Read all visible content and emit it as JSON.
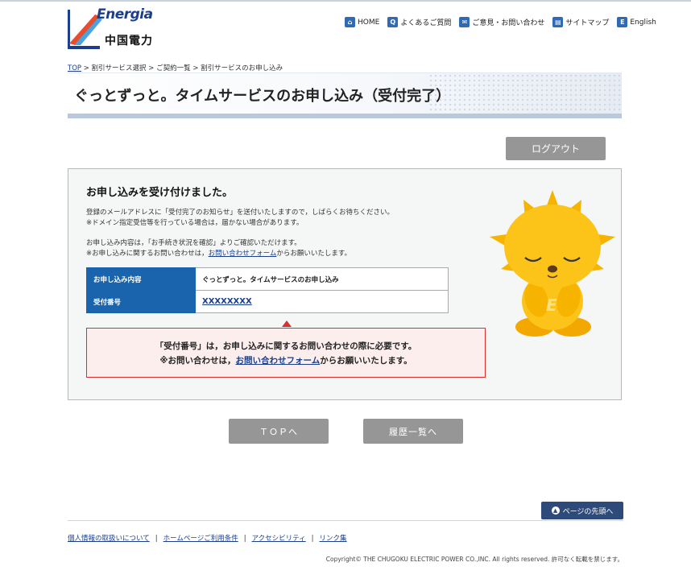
{
  "header": {
    "logo_en": "Energia",
    "logo_jp": "中国電力",
    "nav": [
      {
        "label": "HOME",
        "icon": "home-icon",
        "glyph": "⌂"
      },
      {
        "label": "よくあるご質問",
        "icon": "search-icon",
        "glyph": "Q"
      },
      {
        "label": "ご意見・お問い合わせ",
        "icon": "mail-icon",
        "glyph": "✉"
      },
      {
        "label": "サイトマップ",
        "icon": "sitemap-icon",
        "glyph": "▤"
      },
      {
        "label": "English",
        "icon": "english-icon",
        "glyph": "E"
      }
    ]
  },
  "breadcrumb": {
    "items": [
      "TOP",
      "割引サービス選択",
      "ご契約一覧",
      "割引サービスのお申し込み"
    ],
    "separator": ">"
  },
  "page_title": "ぐっとずっと。タイムサービスのお申し込み（受付完了）",
  "logout_label": "ログアウト",
  "main": {
    "heading": "お申し込みを受け付けました。",
    "para1_line1": "登録のメールアドレスに「受付完了のお知らせ」を送付いたしますので，しばらくお待ちください。",
    "para1_line2": "※ドメイン指定受信等を行っている場合は，届かない場合があります。",
    "para2_line1": "お申し込み内容は，「お手続き状況を確認」よりご確認いただけます。",
    "para2_line2_pre": "※お申し込みに関するお問い合わせは，",
    "para2_line2_link": "お問い合わせフォーム",
    "para2_line2_post": "からお願いいたします。",
    "table": [
      {
        "key": "お申し込み内容",
        "value": "ぐっとずっと。タイムサービスのお申し込み"
      },
      {
        "key": "受付番号",
        "value": "XXXXXXXX"
      }
    ],
    "notice_line1": "「受付番号」は，お申し込みに関するお問い合わせの際に必要です。",
    "notice_line2_pre": "※お問い合わせは，",
    "notice_line2_link": "お問い合わせフォーム",
    "notice_line2_post": "からお願いいたします。"
  },
  "buttons": {
    "top": "ＴＯＰへ",
    "history": "履歴一覧へ"
  },
  "pagetop_label": "ページの先頭へ",
  "footer": {
    "links": [
      "個人情報の取扱いについて",
      "ホームページご利用条件",
      "アクセシビリティ",
      "リンク集"
    ],
    "copyright": "Copyright© THE CHUGOKU ELECTRIC POWER CO.,INC. All rights reserved. 許可なく転載を禁じます。"
  },
  "colors": {
    "brand_blue": "#1b3f8c",
    "table_key_bg": "#1a63ad",
    "notice_border": "#d83030",
    "button_gray": "#969696"
  }
}
